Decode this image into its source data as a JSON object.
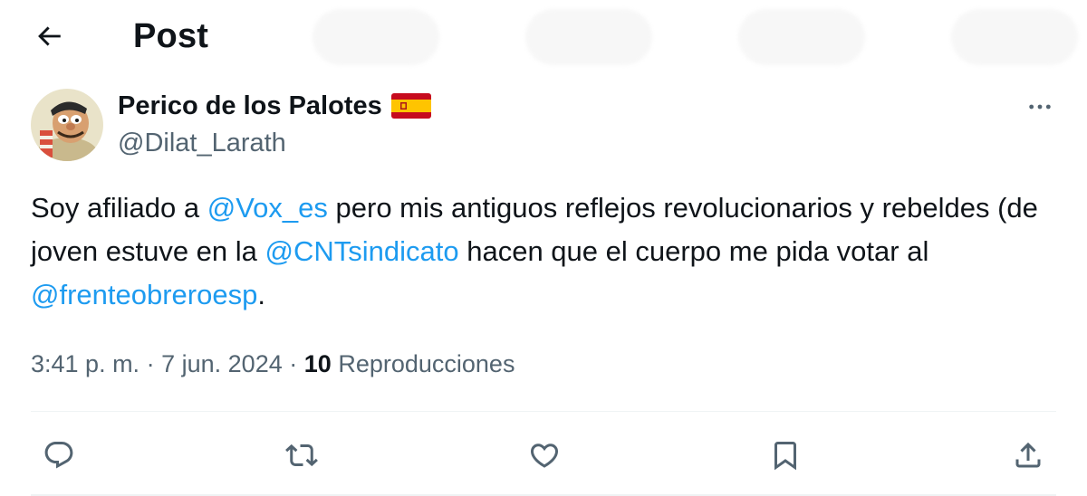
{
  "header": {
    "back_icon": "arrow-left-icon",
    "title": "Post"
  },
  "author": {
    "display_name": "Perico de los Palotes",
    "flag_icon": "spain-flag-icon",
    "handle": "@Dilat_Larath",
    "avatar_icon": "cartoon-avatar-icon"
  },
  "tweet": {
    "part1": "Soy afiliado a ",
    "mention1": "@Vox_es",
    "part2": " pero mis antiguos reflejos revolucionarios y rebeldes (de joven estuve en la ",
    "mention2": "@CNTsindicato",
    "part3": " hacen que el cuerpo me pida votar al ",
    "mention3": "@frenteobreroesp",
    "part4": "."
  },
  "meta": {
    "time": "3:41 p. m.",
    "separator": "·",
    "date": "7 jun. 2024",
    "views_count": "10",
    "views_label": "Reproducciones"
  },
  "actions": [
    "reply-icon",
    "retweet-icon",
    "like-icon",
    "bookmark-icon",
    "share-icon"
  ],
  "colors": {
    "text": "#0f1419",
    "secondary": "#536471",
    "link": "#1d9bf0",
    "divider": "#eff3f4"
  }
}
